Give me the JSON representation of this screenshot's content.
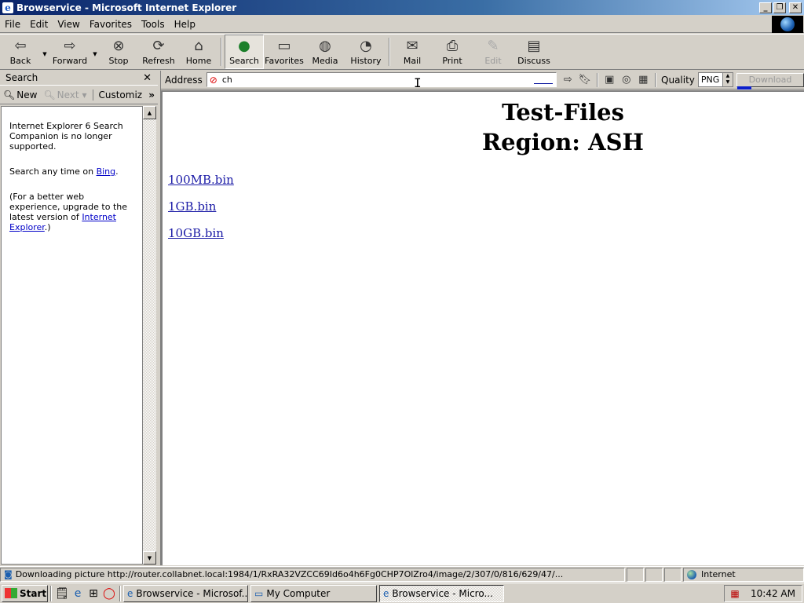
{
  "window": {
    "title": "Browservice - Microsoft Internet Explorer"
  },
  "menu": [
    "File",
    "Edit",
    "View",
    "Favorites",
    "Tools",
    "Help"
  ],
  "toolbar": {
    "back": "Back",
    "forward": "Forward",
    "stop": "Stop",
    "refresh": "Refresh",
    "home": "Home",
    "search": "Search",
    "favorites": "Favorites",
    "media": "Media",
    "history": "History",
    "mail": "Mail",
    "print": "Print",
    "edit": "Edit",
    "discuss": "Discuss"
  },
  "search_pane": {
    "title": "Search",
    "new_label": "New",
    "next_label": "Next",
    "customize_label": "Customiz",
    "msg1": "Internet Explorer 6 Search Companion is no longer supported.",
    "msg2_prefix": "Search any time on ",
    "msg2_link": "Bing",
    "msg2_suffix": ".",
    "msg3_prefix": "(For a better web experience, upgrade to the latest version of ",
    "msg3_link": "Internet Explorer",
    "msg3_suffix": ".)"
  },
  "address": {
    "label": "Address",
    "value": "ch",
    "quality_label": "Quality",
    "quality_value": "PNG",
    "download_label": "Download"
  },
  "page": {
    "heading1": "Test-Files",
    "heading2": "Region: ASH",
    "files": [
      "100MB.bin",
      "1GB.bin",
      "10GB.bin"
    ]
  },
  "status": {
    "text": "Downloading picture http://router.collabnet.local:1984/1/RxRA32VZCC69Id6o4h6Fg0CHP7OlZro4/image/2/307/0/816/629/47/...",
    "zone": "Internet"
  },
  "taskbar": {
    "start": "Start",
    "tasks": [
      "Browservice - Microsof...",
      "My Computer",
      "Browservice - Micro..."
    ],
    "clock": "10:42 AM"
  }
}
